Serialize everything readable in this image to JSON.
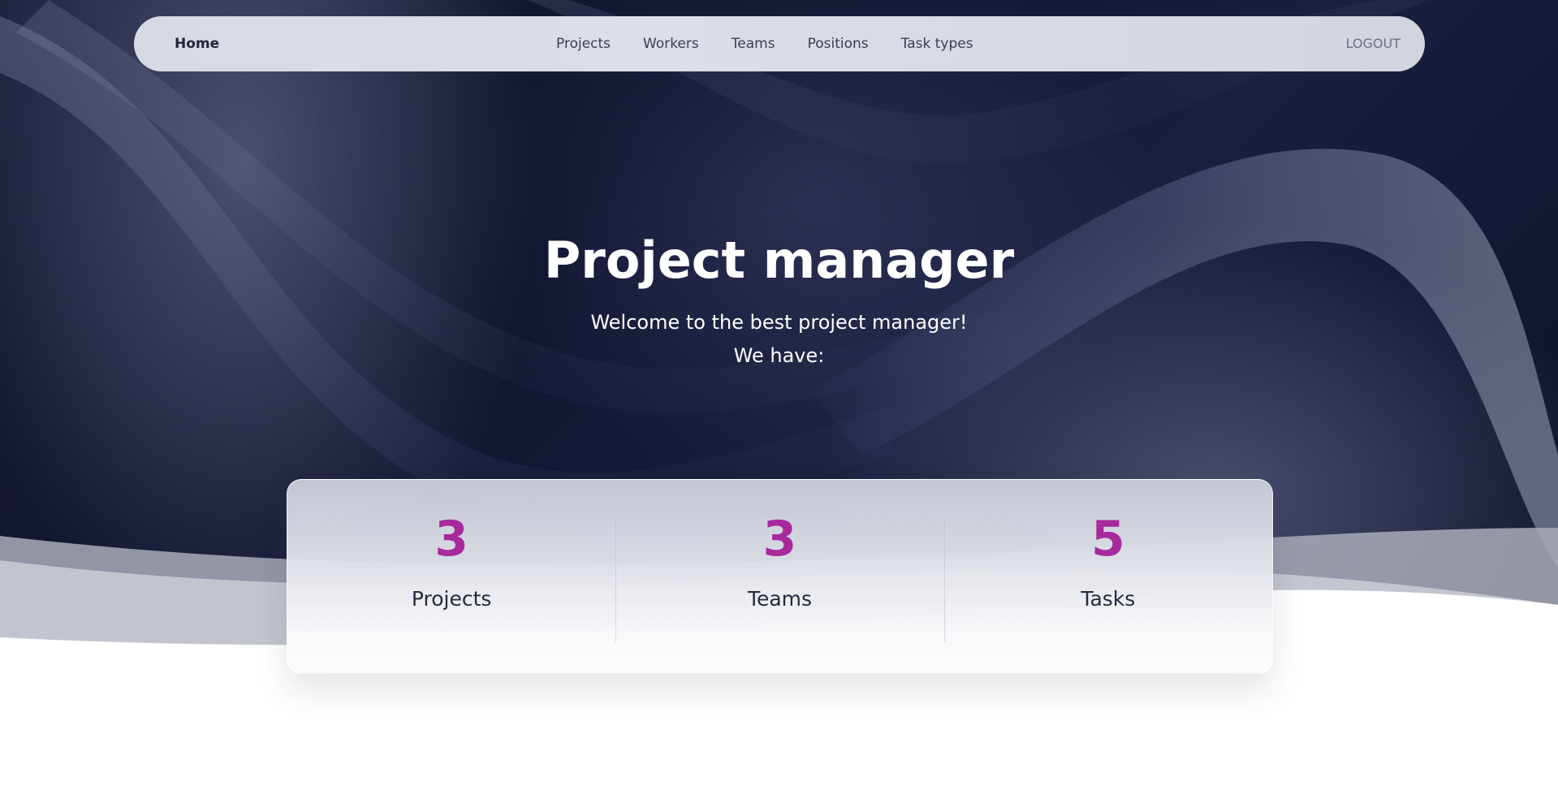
{
  "navbar": {
    "home_label": "Home",
    "links": [
      {
        "label": "Projects"
      },
      {
        "label": "Workers"
      },
      {
        "label": "Teams"
      },
      {
        "label": "Positions"
      },
      {
        "label": "Task types"
      }
    ],
    "logout_label": "LOGOUT"
  },
  "hero": {
    "title": "Project manager",
    "subtitle": "Welcome to the best project manager!",
    "subtitle2": "We have:"
  },
  "stats": [
    {
      "value": "3",
      "label": "Projects"
    },
    {
      "value": "3",
      "label": "Teams"
    },
    {
      "value": "5",
      "label": "Tasks"
    }
  ],
  "colors": {
    "accent": "#a62a9b",
    "hero_dark": "#10132e",
    "navbar_bg": "#d7dae3"
  }
}
